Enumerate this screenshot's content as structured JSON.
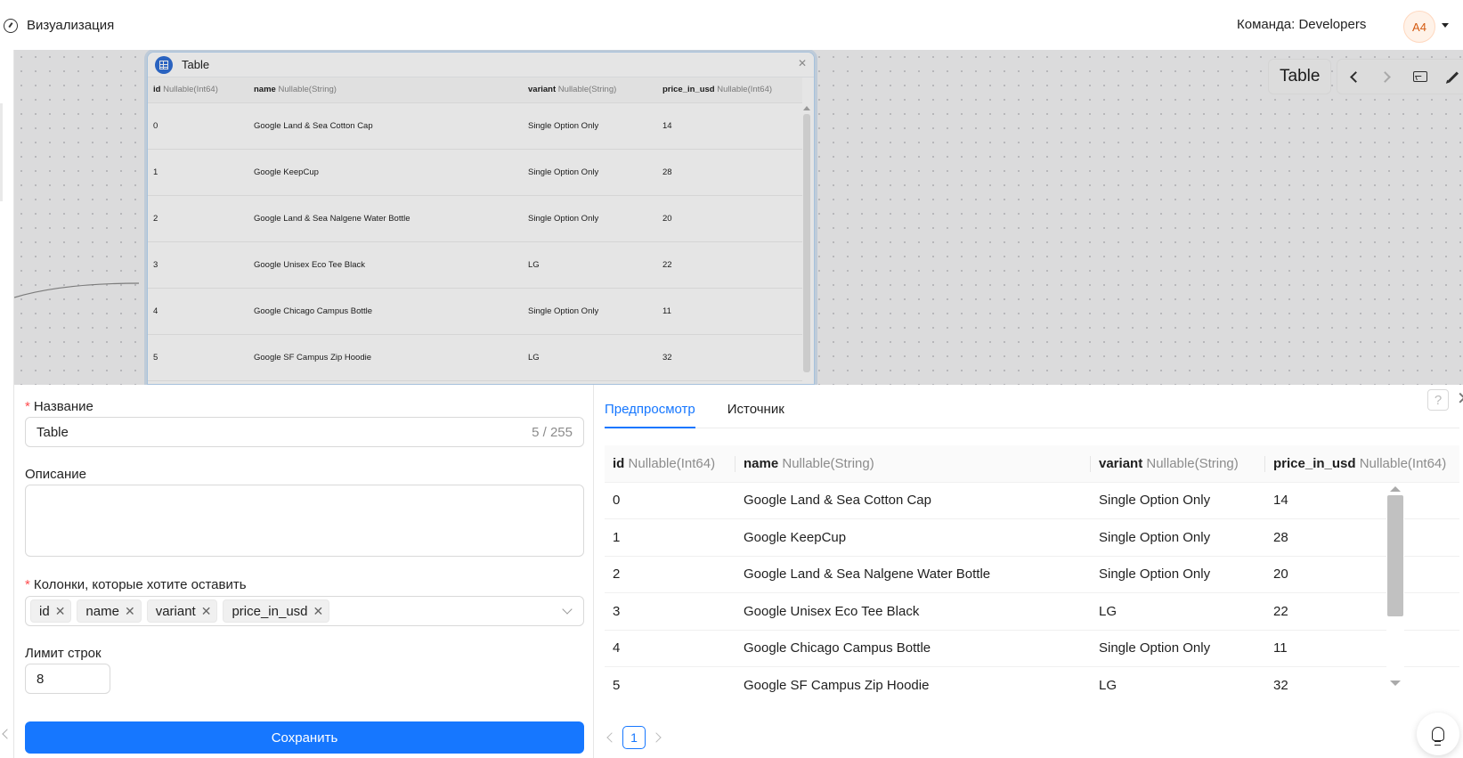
{
  "header": {
    "app_title": "Визуализация",
    "team_label": "Команда: Developers",
    "avatar_initials": "A4"
  },
  "canvas": {
    "node": {
      "title": "Table",
      "close_icon": "close-icon",
      "columns": [
        {
          "name": "id",
          "type": "Nullable(Int64)"
        },
        {
          "name": "name",
          "type": "Nullable(String)"
        },
        {
          "name": "variant",
          "type": "Nullable(String)"
        },
        {
          "name": "price_in_usd",
          "type": "Nullable(Int64)"
        }
      ],
      "rows": [
        [
          "0",
          "Google Land & Sea Cotton Cap",
          "Single Option Only",
          "14"
        ],
        [
          "1",
          "Google KeepCup",
          "Single Option Only",
          "28"
        ],
        [
          "2",
          "Google Land & Sea Nalgene Water Bottle",
          "Single Option Only",
          "20"
        ],
        [
          "3",
          "Google Unisex Eco Tee Black",
          "LG",
          "22"
        ],
        [
          "4",
          "Google Chicago Campus Bottle",
          "Single Option Only",
          "11"
        ],
        [
          "5",
          "Google SF Campus Zip Hoodie",
          "LG",
          "32"
        ]
      ]
    },
    "toolbar": {
      "title": "Table"
    }
  },
  "form": {
    "name_label": "Название",
    "name_value": "Table",
    "name_count": "5 / 255",
    "description_label": "Описание",
    "description_value": "",
    "columns_label": "Колонки, которые хотите оставить",
    "selected_columns": [
      "id",
      "name",
      "variant",
      "price_in_usd"
    ],
    "limit_label": "Лимит строк",
    "limit_value": "8",
    "save_label": "Сохранить"
  },
  "preview": {
    "tabs": [
      {
        "label": "Предпросмотр",
        "active": true
      },
      {
        "label": "Источник",
        "active": false
      }
    ],
    "help_label": "?",
    "columns": [
      {
        "name": "id",
        "type": "Nullable(Int64)"
      },
      {
        "name": "name",
        "type": "Nullable(String)"
      },
      {
        "name": "variant",
        "type": "Nullable(String)"
      },
      {
        "name": "price_in_usd",
        "type": "Nullable(Int64)"
      }
    ],
    "rows": [
      [
        "0",
        "Google Land & Sea Cotton Cap",
        "Single Option Only",
        "14"
      ],
      [
        "1",
        "Google KeepCup",
        "Single Option Only",
        "28"
      ],
      [
        "2",
        "Google Land & Sea Nalgene Water Bottle",
        "Single Option Only",
        "20"
      ],
      [
        "3",
        "Google Unisex Eco Tee Black",
        "LG",
        "22"
      ],
      [
        "4",
        "Google Chicago Campus Bottle",
        "Single Option Only",
        "11"
      ],
      [
        "5",
        "Google SF Campus Zip Hoodie",
        "LG",
        "32"
      ]
    ],
    "pagination": {
      "current_page": "1"
    }
  },
  "colors": {
    "primary": "#1677ff",
    "required": "#ff4d4f",
    "avatar_bg": "#fff2e8",
    "avatar_text": "#d4590f"
  }
}
